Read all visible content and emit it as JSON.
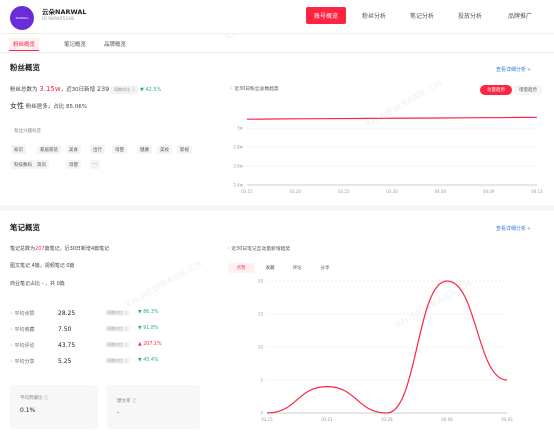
{
  "account": {
    "name": "云朵NARWAL",
    "id": "ID 989405168"
  },
  "nav": [
    {
      "label": "账号概览",
      "active": true
    },
    {
      "label": "粉丝分析",
      "active": false
    },
    {
      "label": "笔记分析",
      "active": false
    },
    {
      "label": "投放分析",
      "active": false
    },
    {
      "label": "品牌推广",
      "active": false
    }
  ],
  "subtabs": [
    {
      "label": "粉丝概览",
      "active": true
    },
    {
      "label": "笔记概览",
      "active": false
    },
    {
      "label": "品牌概览",
      "active": false
    }
  ],
  "fans": {
    "title": "粉丝概览",
    "detail_link": "查看详细分析 »",
    "total_prefix": "粉丝总数为",
    "total": "3.15w",
    "recent_mid": "，近30日新增",
    "recent": "239",
    "compare_label": "同期对比 ⓘ",
    "compare_value": "▼ 42.5%",
    "gender_main": "女性",
    "gender_sub": "粉丝居多，占比",
    "gender_pct": "85.06%",
    "interest_label": "粉丝兴趣标签",
    "tags": [
      "知识",
      "家居家装",
      "美食",
      "出行",
      "母婴",
      "健康",
      "美妆",
      "影视",
      "科技数码",
      "资讯",
      "母婴",
      "···"
    ],
    "chart_title": "近30日粉丝总数趋势",
    "toggle_active": "总量趋势",
    "toggle_inactive": "增量趋势"
  },
  "notes": {
    "title": "笔记概览",
    "detail_link": "查看详细分析 »",
    "line1_prefix": "笔记总数为",
    "total": "207",
    "line1_mid": "篇笔记，近30日新增",
    "recent": "4",
    "line1_suffix": "篇笔记",
    "line2": "图文笔记 4篇，视频笔记 0篇",
    "line3": "商业笔记占比 - ，共 0篇",
    "chart_title": "近30日笔记互动量新增趋势",
    "chart_tabs": [
      "点赞",
      "收藏",
      "评论",
      "分享"
    ],
    "metrics": [
      {
        "label": "平均点赞",
        "value": "28.25",
        "compare": "同期对比 ⓘ",
        "delta": "▼ 86.3%",
        "dir": "down"
      },
      {
        "label": "平均收藏",
        "value": "7.50",
        "compare": "同期对比 ⓘ",
        "delta": "▼ 91.8%",
        "dir": "down"
      },
      {
        "label": "平均评论",
        "value": "43.75",
        "compare": "同期对比 ⓘ",
        "delta": "▲ 207.1%",
        "dir": "up"
      },
      {
        "label": "平均分享",
        "value": "5.25",
        "compare": "同期对比 ⓘ",
        "delta": "▼ 45.4%",
        "dir": "down"
      }
    ],
    "box1_label": "平均赞藏比 ⓘ",
    "box1_value": "0.1%",
    "box2_label": "爆文率 ⓘ",
    "box2_value": "-"
  },
  "watermark": "XH.NEWRANK.CN",
  "chart_data": [
    {
      "type": "line",
      "title": "近30日粉丝总数趋势",
      "x": [
        "03.15",
        "03.20",
        "03.25",
        "03.30",
        "04.04",
        "04.09",
        "04.13"
      ],
      "yticks": [
        "2.4w",
        "2.6w",
        "2.8w",
        "3w"
      ],
      "ylim": [
        24000,
        31500
      ],
      "series": [
        {
          "values": [
            30950,
            30990,
            31020,
            31050,
            31080,
            31110,
            31150
          ],
          "color": "#ff2442"
        }
      ]
    },
    {
      "type": "line",
      "title": "近30日笔记互动量新增趋势",
      "x": [
        "03.15",
        "03.21",
        "03.28",
        "04.08",
        "04.03"
      ],
      "yticks": [
        "0",
        "5",
        "10",
        "15",
        "20"
      ],
      "ylim": [
        0,
        20
      ],
      "series": [
        {
          "values": [
            0,
            4,
            0,
            20,
            5
          ],
          "color": "#ff2442"
        }
      ]
    }
  ]
}
